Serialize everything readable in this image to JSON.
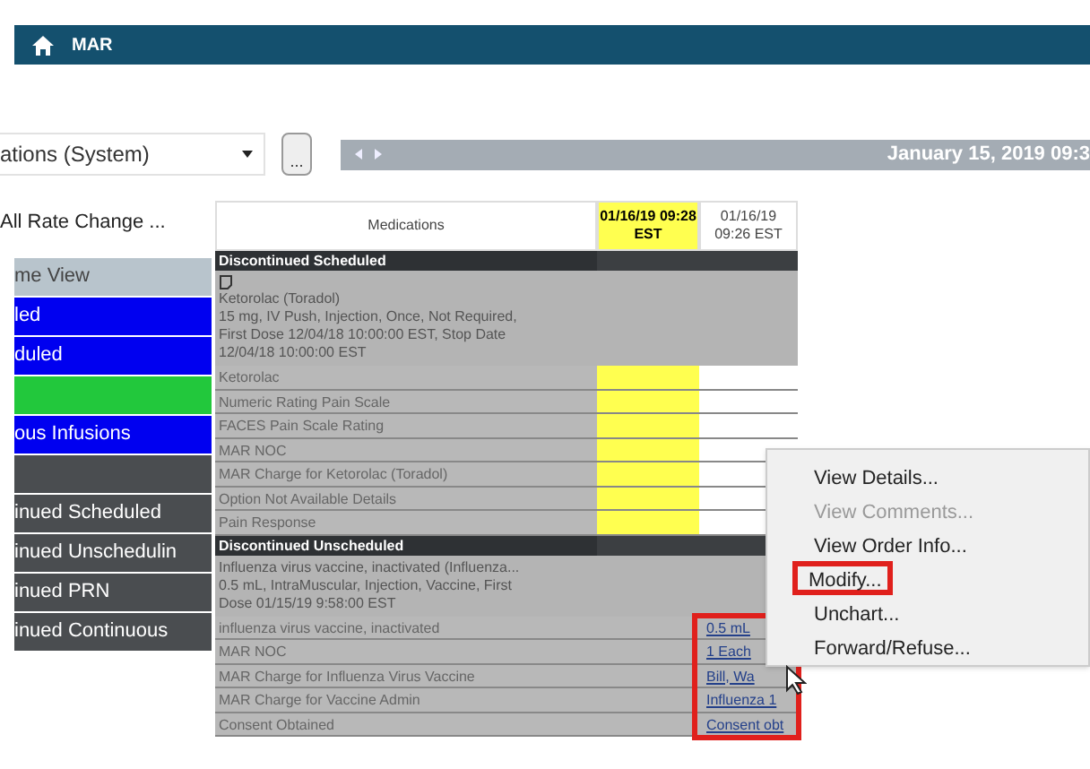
{
  "header": {
    "title": "MAR"
  },
  "filter": {
    "value": "ations (System)"
  },
  "more_button": {
    "label": "..."
  },
  "date_bar": {
    "date": "January 15, 2019 09:3"
  },
  "view_label": "All Rate Change ...",
  "view_items": [
    {
      "label": "me View",
      "color": "#b8c4cc"
    },
    {
      "label": "led",
      "color": "#0000f0"
    },
    {
      "label": "duled",
      "color": "#0000f0"
    },
    {
      "color": "#22c83c"
    },
    {
      "label": "ous Infusions",
      "color": "#0000f0"
    },
    {
      "color": "#4a4d50"
    },
    {
      "label": "inued Scheduled",
      "color": "#4a4d50"
    },
    {
      "label": "inued Unschedulin",
      "color": "#4a4d50"
    },
    {
      "label": "inued PRN",
      "color": "#4a4d50"
    },
    {
      "label": "inued Continuous",
      "color": "#4a4d50"
    }
  ],
  "table": {
    "columns": [
      {
        "label": "Medications",
        "selected": false
      },
      {
        "label": "01/16/19 09:28 EST",
        "selected": true
      },
      {
        "label": "01/16/19 09:26 EST",
        "selected": false
      }
    ],
    "sections": [
      {
        "title": "Discontinued Scheduled",
        "highlight_results": false,
        "order": [
          "Ketorolac (Toradol)",
          "15 mg, IV Push, Injection, Once, Not Required,",
          "First Dose 12/04/18 10:00:00 EST, Stop Date",
          "12/04/18 10:00:00 EST"
        ],
        "rows": [
          {
            "label": "Ketorolac",
            "value": ""
          },
          {
            "label": "Numeric Rating Pain Scale",
            "value": ""
          },
          {
            "label": "FACES Pain Scale Rating",
            "value": ""
          },
          {
            "label": "MAR NOC",
            "value": ""
          },
          {
            "label": "MAR Charge for Ketorolac (Toradol)",
            "value": ""
          },
          {
            "label": "Option Not Available Details",
            "value": ""
          },
          {
            "label": "Pain Response",
            "value": ""
          }
        ]
      },
      {
        "title": "Discontinued Unscheduled",
        "highlight_results": true,
        "order": [
          "Influenza virus vaccine, inactivated (Influenza...",
          "0.5 mL, IntraMuscular, Injection, Vaccine, First",
          "Dose 01/15/19 9:58:00 EST"
        ],
        "rows": [
          {
            "label": "influenza virus vaccine, inactivated",
            "value": "0.5 mL"
          },
          {
            "label": "MAR NOC",
            "value": "1 Each"
          },
          {
            "label": "MAR Charge for Influenza Virus Vaccine",
            "value": "Bill, Wa"
          },
          {
            "label": "MAR Charge for Vaccine Admin",
            "value": "Influenza 1"
          },
          {
            "label": "Consent Obtained",
            "value": "Consent obt"
          }
        ]
      }
    ]
  },
  "context_menu": [
    {
      "label": "View Details...",
      "disabled": false,
      "highlighted": false
    },
    {
      "label": "View Comments...",
      "disabled": true,
      "highlighted": false
    },
    {
      "label": "View Order Info...",
      "disabled": false,
      "highlighted": false
    },
    {
      "label": "Modify...",
      "disabled": false,
      "highlighted": true
    },
    {
      "label": "Unchart...",
      "disabled": false,
      "highlighted": false
    },
    {
      "label": "Forward/Refuse...",
      "disabled": false,
      "highlighted": false
    }
  ]
}
